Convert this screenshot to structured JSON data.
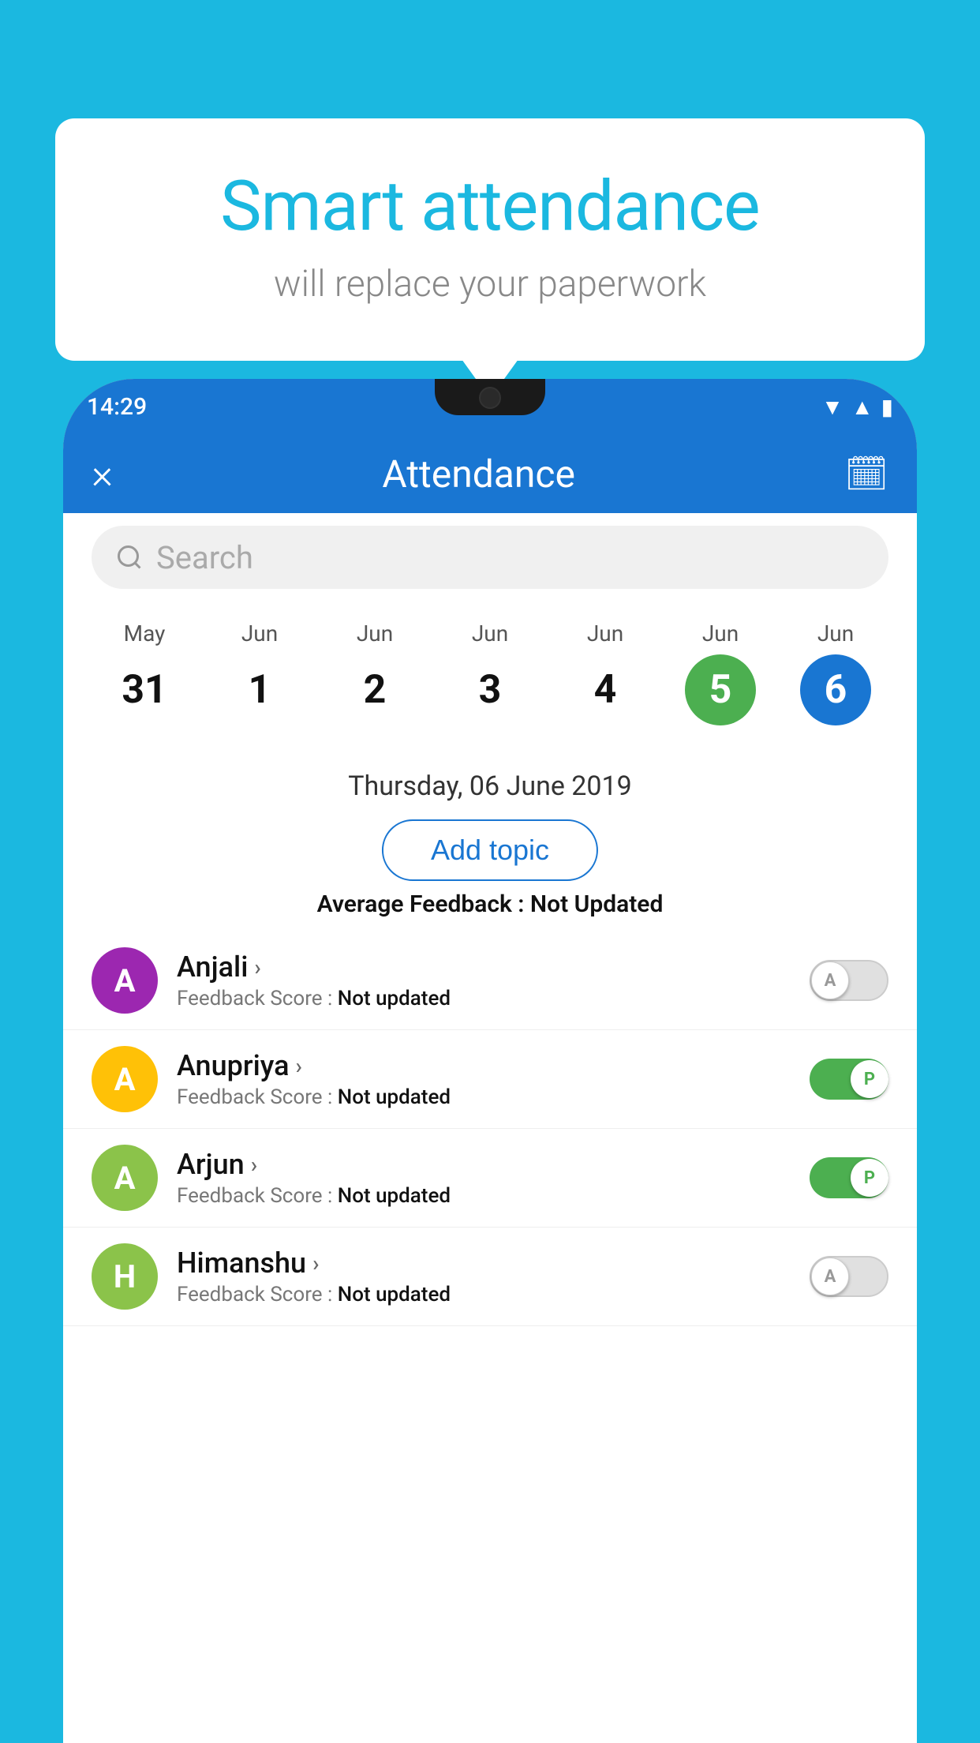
{
  "background_color": "#1bb8e0",
  "speech_bubble": {
    "title": "Smart attendance",
    "subtitle": "will replace your paperwork"
  },
  "status_bar": {
    "time": "14:29",
    "wifi_icon": "▼",
    "signal_icon": "▲",
    "battery_icon": "▮"
  },
  "app_bar": {
    "title": "Attendance",
    "close_icon": "×",
    "calendar_icon": "📅"
  },
  "search": {
    "placeholder": "Search"
  },
  "calendar": {
    "days": [
      {
        "month": "May",
        "date": "31",
        "state": "normal"
      },
      {
        "month": "Jun",
        "date": "1",
        "state": "normal"
      },
      {
        "month": "Jun",
        "date": "2",
        "state": "normal"
      },
      {
        "month": "Jun",
        "date": "3",
        "state": "normal"
      },
      {
        "month": "Jun",
        "date": "4",
        "state": "normal"
      },
      {
        "month": "Jun",
        "date": "5",
        "state": "today"
      },
      {
        "month": "Jun",
        "date": "6",
        "state": "selected"
      }
    ]
  },
  "selected_date": "Thursday, 06 June 2019",
  "add_topic_label": "Add topic",
  "avg_feedback_label": "Average Feedback :",
  "avg_feedback_value": "Not Updated",
  "students": [
    {
      "name": "Anjali",
      "avatar_letter": "A",
      "avatar_color": "#9c27b0",
      "feedback": "Not updated",
      "toggle": "off",
      "toggle_label": "A"
    },
    {
      "name": "Anupriya",
      "avatar_letter": "A",
      "avatar_color": "#ffc107",
      "feedback": "Not updated",
      "toggle": "on",
      "toggle_label": "P"
    },
    {
      "name": "Arjun",
      "avatar_letter": "A",
      "avatar_color": "#8bc34a",
      "feedback": "Not updated",
      "toggle": "on",
      "toggle_label": "P"
    },
    {
      "name": "Himanshu",
      "avatar_letter": "H",
      "avatar_color": "#8bc34a",
      "feedback": "Not updated",
      "toggle": "off",
      "toggle_label": "A"
    }
  ]
}
